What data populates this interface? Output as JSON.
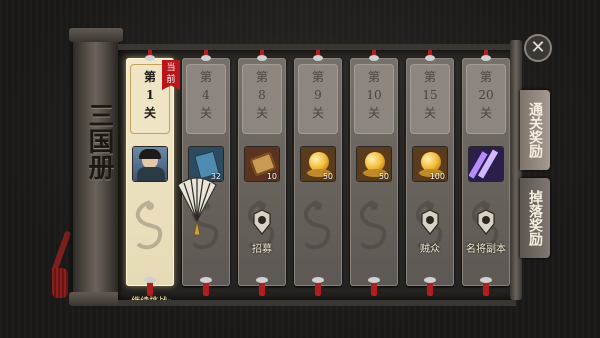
{
  "book_title": "三国册",
  "close_icon_char": "✕",
  "tabs": {
    "clear_rewards": "通关奖励",
    "drop_rewards": "掉落奖励"
  },
  "current_badge": "当前",
  "continue_label": "继续挑战",
  "stages": [
    {
      "prefix": "第",
      "num": "1",
      "suffix": "关",
      "active": true,
      "icon": "hero-portrait",
      "qty": "",
      "reward": ""
    },
    {
      "prefix": "第",
      "num": "4",
      "suffix": "关",
      "active": false,
      "icon": "blue-book",
      "qty": "32",
      "reward": ""
    },
    {
      "prefix": "第",
      "num": "8",
      "suffix": "关",
      "active": false,
      "icon": "scroll-item",
      "qty": "10",
      "reward": "招募"
    },
    {
      "prefix": "第",
      "num": "9",
      "suffix": "关",
      "active": false,
      "icon": "gold-orb",
      "qty": "50",
      "reward": ""
    },
    {
      "prefix": "第",
      "num": "10",
      "suffix": "关",
      "active": false,
      "icon": "gold-orb",
      "qty": "50",
      "reward": ""
    },
    {
      "prefix": "第",
      "num": "15",
      "suffix": "关",
      "active": false,
      "icon": "gold-orb",
      "qty": "100",
      "reward": "贼众"
    },
    {
      "prefix": "第",
      "num": "20",
      "suffix": "关",
      "active": false,
      "icon": "purple-crystal",
      "qty": "",
      "reward": "名将副本"
    }
  ]
}
